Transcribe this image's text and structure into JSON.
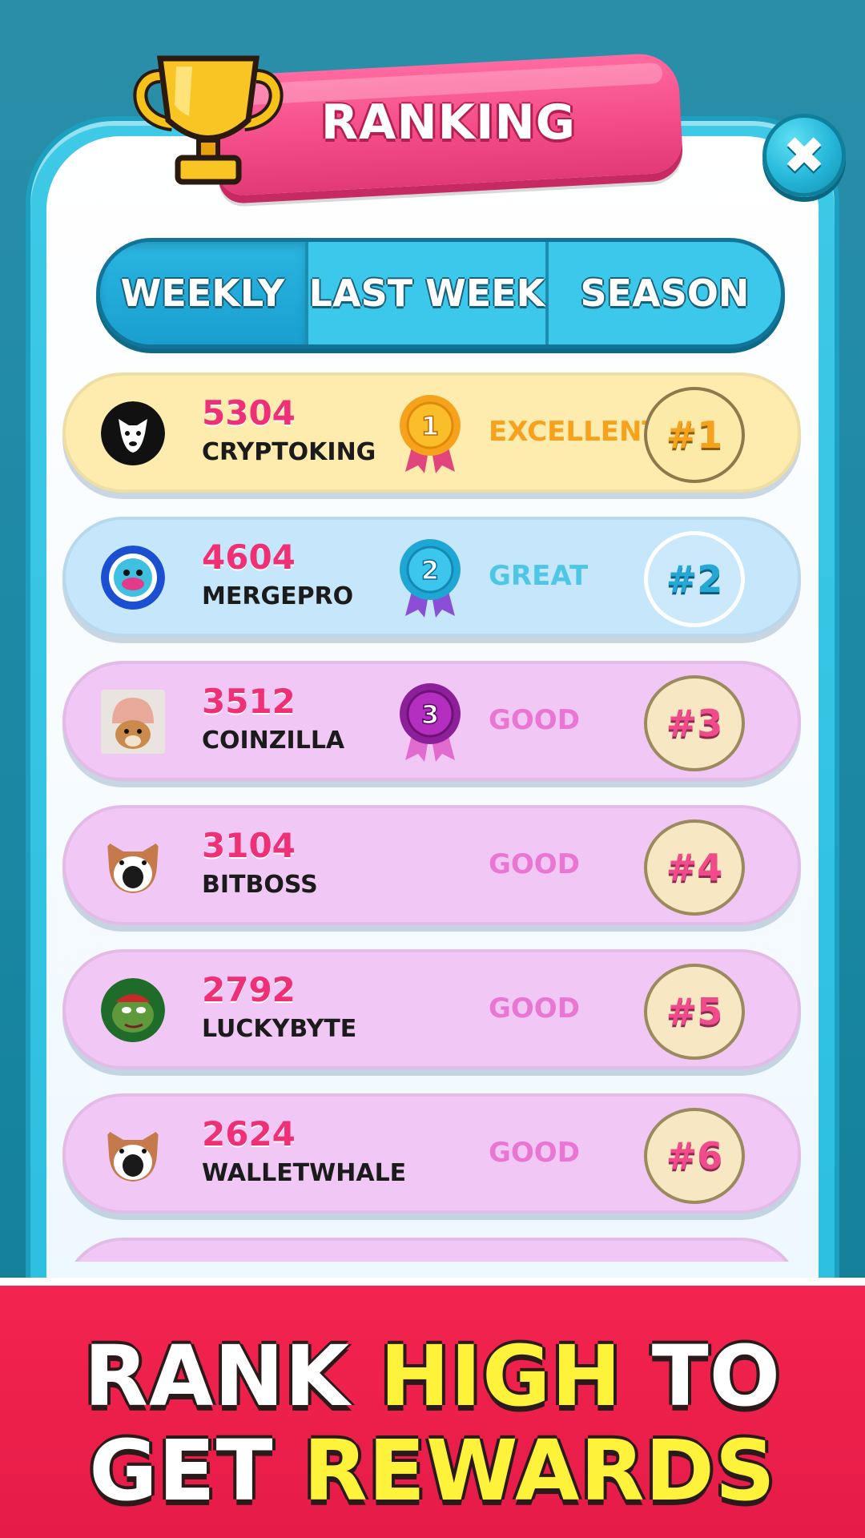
{
  "header": {
    "title": "RANKING"
  },
  "close": {
    "label": "✖"
  },
  "tabs": [
    {
      "label": "WEEKLY",
      "active": true
    },
    {
      "label": "LAST WEEK",
      "active": false
    },
    {
      "label": "SEASON",
      "active": false
    }
  ],
  "rankings": [
    {
      "score": "5304",
      "name": "CRYPTOKING",
      "medal": "1",
      "grade": "EXCELLENT",
      "rank": "#1"
    },
    {
      "score": "4604",
      "name": "MERGEPRO",
      "medal": "2",
      "grade": "GREAT",
      "rank": "#2"
    },
    {
      "score": "3512",
      "name": "COINZILLA",
      "medal": "3",
      "grade": "GOOD",
      "rank": "#3"
    },
    {
      "score": "3104",
      "name": "BITBOSS",
      "grade": "GOOD",
      "rank": "#4"
    },
    {
      "score": "2792",
      "name": "LUCKYBYTE",
      "grade": "GOOD",
      "rank": "#5"
    },
    {
      "score": "2624",
      "name": "WALLETWHALE",
      "grade": "GOOD",
      "rank": "#6"
    }
  ],
  "banner": {
    "line1_a": "RANK",
    "line1_b": "HIGH",
    "line1_c": "TO",
    "line2_a": "GET",
    "line2_b": "REWARDS"
  },
  "colors": {
    "background": "#1f8aa6",
    "ribbon": "#f24a86",
    "score": "#ef2f76",
    "excellent": "#f8a11d",
    "great": "#4ec7e6",
    "good": "#e876d2",
    "banner": "#e61b47",
    "banner_highlight": "#fff23a"
  }
}
